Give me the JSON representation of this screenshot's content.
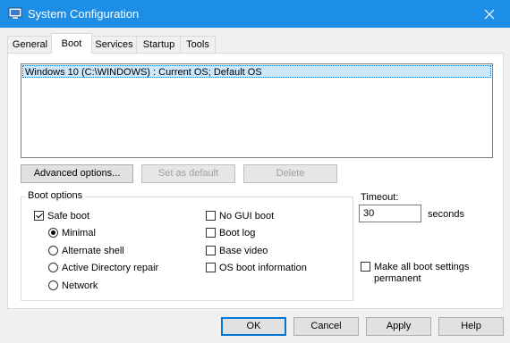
{
  "window": {
    "title": "System Configuration",
    "close_icon": "close-icon"
  },
  "tabs": [
    {
      "label": "General",
      "active": false
    },
    {
      "label": "Boot",
      "active": true
    },
    {
      "label": "Services",
      "active": false
    },
    {
      "label": "Startup",
      "active": false
    },
    {
      "label": "Tools",
      "active": false
    }
  ],
  "boot_list": {
    "items": [
      "Windows 10 (C:\\WINDOWS) : Current OS; Default OS"
    ],
    "selected_index": 0
  },
  "list_buttons": {
    "advanced": "Advanced options...",
    "set_default": "Set as default",
    "delete": "Delete"
  },
  "boot_options": {
    "legend": "Boot options",
    "safe_boot": {
      "label": "Safe boot",
      "checked": true
    },
    "radios": [
      {
        "label": "Minimal",
        "checked": true
      },
      {
        "label": "Alternate shell",
        "checked": false
      },
      {
        "label": "Active Directory repair",
        "checked": false
      },
      {
        "label": "Network",
        "checked": false
      }
    ],
    "right_checks": [
      {
        "label": "No GUI boot",
        "checked": false
      },
      {
        "label": "Boot log",
        "checked": false
      },
      {
        "label": "Base video",
        "checked": false
      },
      {
        "label": "OS boot information",
        "checked": false
      }
    ]
  },
  "timeout": {
    "label": "Timeout:",
    "value": "30",
    "unit": "seconds"
  },
  "make_permanent": {
    "label_line1": "Make all boot settings",
    "label_line2": "permanent",
    "checked": false
  },
  "footer": {
    "ok": "OK",
    "cancel": "Cancel",
    "apply": "Apply",
    "help": "Help"
  },
  "colors": {
    "titlebar": "#1c8ee6",
    "selection": "#cce8ff",
    "accent": "#0078d7"
  }
}
